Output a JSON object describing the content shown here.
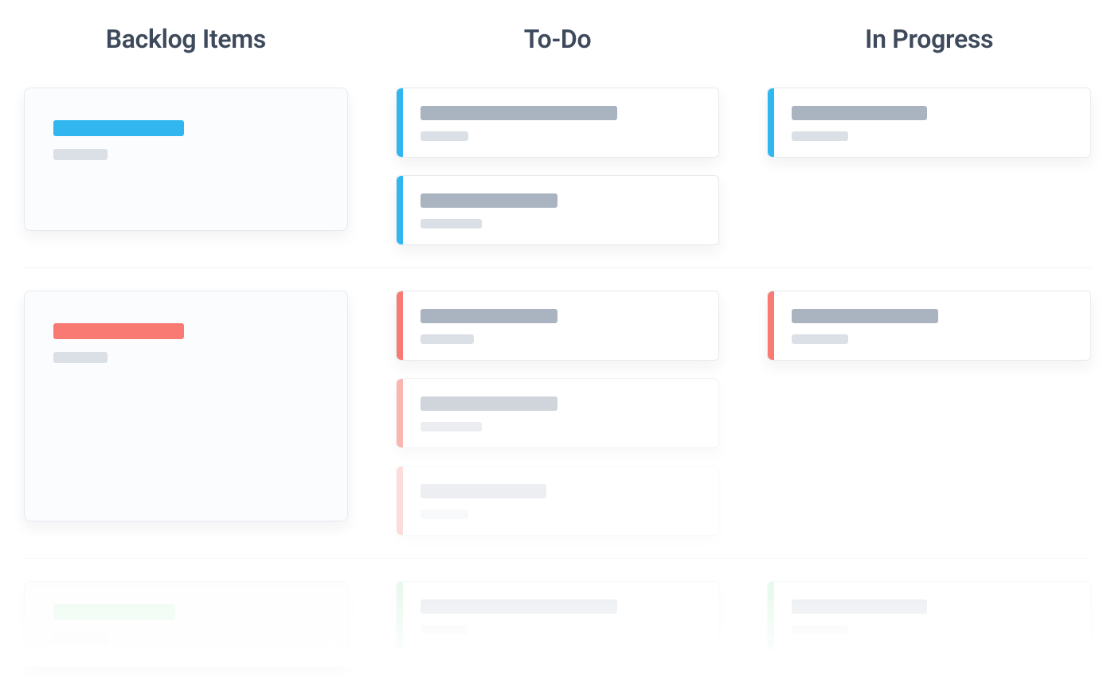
{
  "board": {
    "columns": {
      "backlog": {
        "title": "Backlog Items"
      },
      "todo": {
        "title": "To-Do"
      },
      "inprogress": {
        "title": "In Progress"
      }
    },
    "colors": {
      "blue": "#31b6f0",
      "red": "#f87a72",
      "green": "#a7e9be"
    },
    "lanes": [
      {
        "accent": "blue",
        "backlog_card_title_width": "48%",
        "todo": [
          {
            "title_width": "70%",
            "subtitle_width": "17%"
          },
          {
            "title_width": "49%",
            "subtitle_width": "22%"
          }
        ],
        "inprogress": [
          {
            "title_width": "48%",
            "subtitle_width": "20%"
          }
        ]
      },
      {
        "accent": "red",
        "backlog_card_title_width": "48%",
        "todo": [
          {
            "title_width": "49%",
            "subtitle_width": "19%"
          },
          {
            "title_width": "49%",
            "subtitle_width": "22%"
          },
          {
            "title_width": "45%",
            "subtitle_width": "17%"
          }
        ],
        "inprogress": [
          {
            "title_width": "52%",
            "subtitle_width": "20%"
          }
        ]
      },
      {
        "accent": "green",
        "backlog_card_title_width": "45%",
        "todo": [
          {
            "title_width": "70%",
            "subtitle_width": "17%"
          }
        ],
        "inprogress": [
          {
            "title_width": "48%",
            "subtitle_width": "20%"
          }
        ]
      }
    ]
  }
}
